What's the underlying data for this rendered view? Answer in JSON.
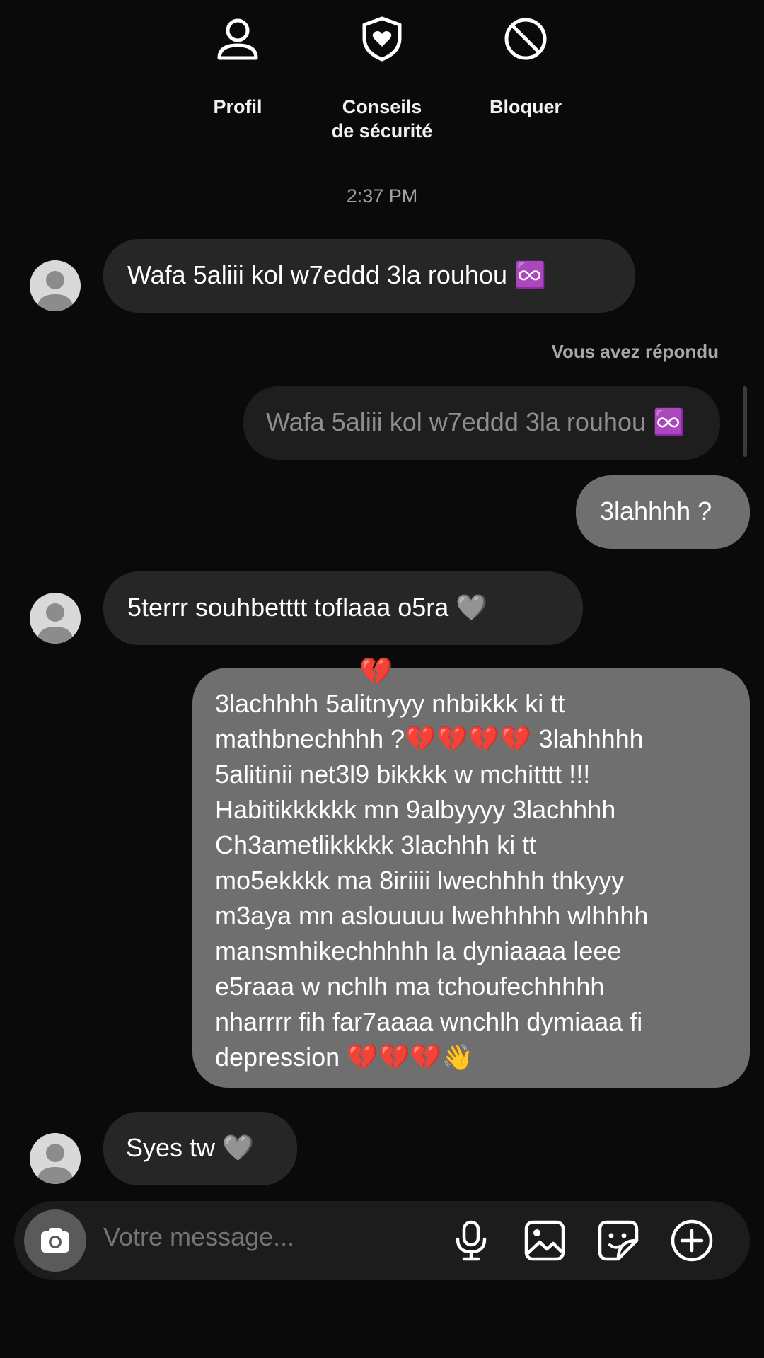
{
  "actions": {
    "profile": "Profil",
    "safety_line1": "Conseils",
    "safety_line2": "de sécurité",
    "block": "Bloquer"
  },
  "timestamp": "2:37 PM",
  "messages": [
    {
      "side": "in",
      "text": "Wafa 5aliii kol w7eddd 3la rouhou ♾️"
    },
    {
      "side": "reply_label",
      "text": "Vous avez répondu"
    },
    {
      "side": "quoted",
      "text": "Wafa 5aliii kol w7eddd 3la rouhou ♾️"
    },
    {
      "side": "out",
      "text": "3lahhhh ?"
    },
    {
      "side": "in",
      "text": "5terrr souhbetttt toflaaa o5ra 🩶"
    },
    {
      "side": "out",
      "reaction": "💔",
      "lines": [
        "3lachhhh 5alitnyyy nhbikkk ki tt",
        "mathbnechhhh ?💔💔💔💔 3lahhhhh",
        "5alitinii net3l9 bikkkk w mchitttt !!!",
        "Habitikkkkkk mn 9albyyyy 3lachhhh",
        "Ch3ametlikkkkk 3lachhh ki tt",
        "mo5ekkkk ma 8iriiii lwechhhh thkyyy",
        "m3aya mn aslouuuu lwehhhhh wlhhhh",
        "mansmhikechhhhh la dyniaaaa leee",
        "e5raaa w nchlh ma tchoufechhhhh",
        "nharrrr fih far7aaaa wnchlh dymiaaa fi",
        "depression 💔💔💔👋"
      ]
    },
    {
      "side": "in",
      "text": "Syes tw 🩶"
    }
  ],
  "composer": {
    "placeholder": "Votre message..."
  },
  "icons": {
    "profile": "person-icon",
    "safety": "shield-heart-icon",
    "block": "block-icon",
    "camera": "camera-icon",
    "mic": "microphone-icon",
    "gallery": "image-icon",
    "sticker": "sticker-icon",
    "more": "plus-circle-icon"
  },
  "colors": {
    "background": "#0a0a0a",
    "incoming_bubble": "#262626",
    "outgoing_bubble": "#6f6f6f"
  }
}
